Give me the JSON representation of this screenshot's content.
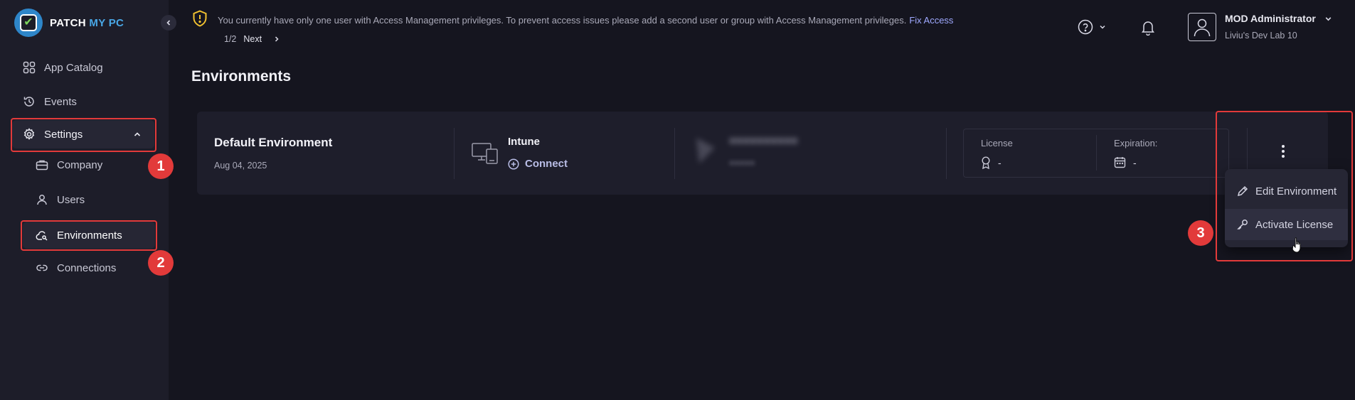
{
  "brand": {
    "logo_part1": "PATCH",
    "logo_part2": "MY PC"
  },
  "sidebar": {
    "items": [
      {
        "label": "App Catalog",
        "icon": "grid-icon"
      },
      {
        "label": "Events",
        "icon": "history-icon"
      },
      {
        "label": "Settings",
        "icon": "gear-icon"
      },
      {
        "label": "Company",
        "icon": "briefcase-icon"
      },
      {
        "label": "Users",
        "icon": "user-icon"
      },
      {
        "label": "Environments",
        "icon": "cloud-key-icon"
      },
      {
        "label": "Connections",
        "icon": "link-icon"
      }
    ]
  },
  "banner": {
    "message": "You currently have only one user with Access Management privileges. To prevent access issues please add a second user or group with Access Management privileges.",
    "link": "Fix Access",
    "pager": "1/2",
    "next": "Next"
  },
  "user": {
    "name": "MOD Administrator",
    "tenant": "Liviu's Dev Lab 10"
  },
  "page": {
    "title": "Environments"
  },
  "environment": {
    "name": "Default Environment",
    "date": "Aug 04, 2025",
    "provider": "Intune",
    "connect_label": "Connect",
    "license_label": "License",
    "license_value": "-",
    "expiration_label": "Expiration:",
    "expiration_value": "-"
  },
  "menu": {
    "items": [
      "Edit Environment",
      "Activate License"
    ]
  },
  "annotations": {
    "badge1": "1",
    "badge2": "2",
    "badge3": "3"
  },
  "colors": {
    "accent_red": "#e23a3a",
    "brand_blue": "#49a7e6",
    "link": "#9fa9ff"
  }
}
